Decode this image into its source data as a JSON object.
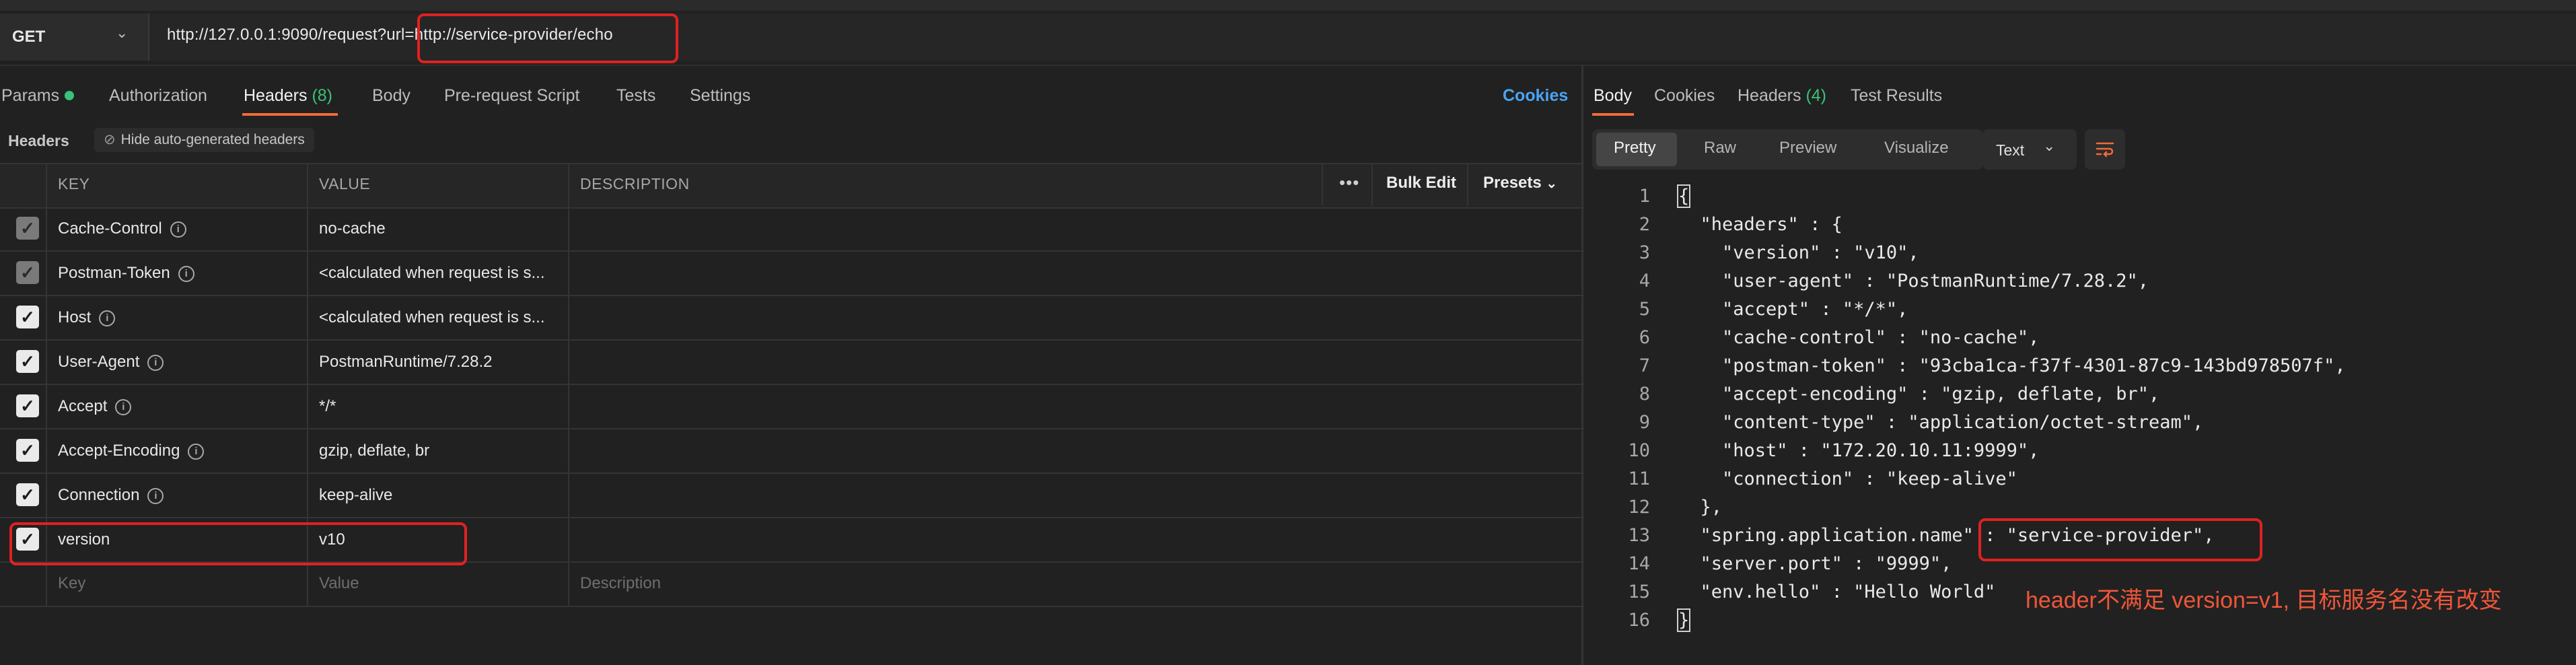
{
  "request": {
    "method": "GET",
    "url_base": "http://127.0.0.1:9090/request?url=",
    "url_param": "http://service-provider/echo"
  },
  "left_tabs": [
    {
      "label": "Params"
    },
    {
      "label": "Authorization"
    },
    {
      "label": "Headers",
      "count": "(8)"
    },
    {
      "label": "Body"
    },
    {
      "label": "Pre-request Script"
    },
    {
      "label": "Tests"
    },
    {
      "label": "Settings"
    }
  ],
  "cookies_link": "Cookies",
  "headers_section": {
    "label": "Headers",
    "hide_auto_label": "Hide auto-generated headers"
  },
  "table": {
    "columns": [
      "KEY",
      "VALUE",
      "DESCRIPTION"
    ],
    "bulk_edit": "Bulk Edit",
    "presets": "Presets",
    "rows": [
      {
        "key": "Cache-Control",
        "value": "no-cache"
      },
      {
        "key": "Postman-Token",
        "value": "<calculated when request is s..."
      },
      {
        "key": "Host",
        "value": "<calculated when request is s..."
      },
      {
        "key": "User-Agent",
        "value": "PostmanRuntime/7.28.2"
      },
      {
        "key": "Accept",
        "value": "*/*"
      },
      {
        "key": "Accept-Encoding",
        "value": "gzip, deflate, br"
      },
      {
        "key": "Connection",
        "value": "keep-alive"
      },
      {
        "key": "version",
        "value": "v10"
      }
    ],
    "new_row": {
      "key": "Key",
      "value": "Value",
      "description": "Description"
    }
  },
  "response_tabs": [
    {
      "label": "Body"
    },
    {
      "label": "Cookies"
    },
    {
      "label": "Headers",
      "count": "(4)"
    },
    {
      "label": "Test Results"
    }
  ],
  "view_modes": [
    "Pretty",
    "Raw",
    "Preview",
    "Visualize"
  ],
  "format_select": "Text",
  "code_lines": [
    "{",
    "  \"headers\" : {",
    "    \"version\" : \"v10\",",
    "    \"user-agent\" : \"PostmanRuntime/7.28.2\",",
    "    \"accept\" : \"*/*\",",
    "    \"cache-control\" : \"no-cache\",",
    "    \"postman-token\" : \"93cba1ca-f37f-4301-87c9-143bd978507f\",",
    "    \"accept-encoding\" : \"gzip, deflate, br\",",
    "    \"content-type\" : \"application/octet-stream\",",
    "    \"host\" : \"172.20.10.11:9999\",",
    "    \"connection\" : \"keep-alive\"",
    "  },",
    "  \"spring.application.name\" : \"service-provider\",",
    "  \"server.port\" : \"9999\",",
    "  \"env.hello\" : \"Hello World\"",
    "}"
  ],
  "annotation": "header不满足 version=v1, 目标服务名没有改变",
  "colors": {
    "accent": "#f26b3a",
    "highlight": "#e02121",
    "count": "#3ac27a",
    "link": "#4aa4f2",
    "annotation": "#f0563a"
  }
}
